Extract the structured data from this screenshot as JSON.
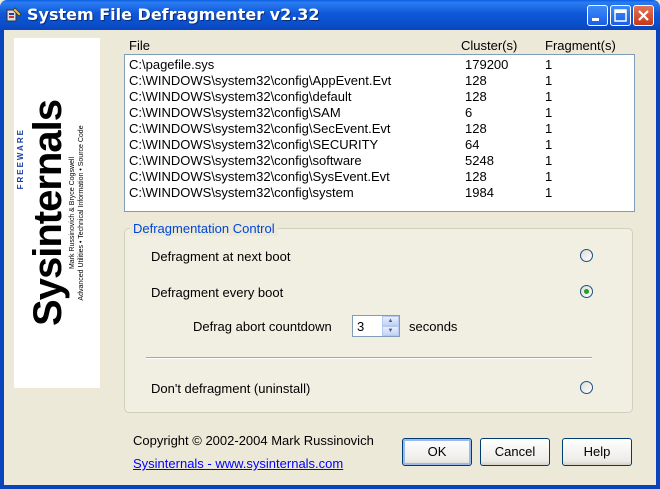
{
  "window": {
    "title": "System File Defragmenter v2.32",
    "controls": [
      "minimize-icon",
      "maximize-icon",
      "close-icon"
    ]
  },
  "logo": {
    "brand": "Sysinternals",
    "freeware": "FREEWARE",
    "tagline1": "Mark Russinovich & Bryce Cogswell",
    "tagline2": "Advanced Utilities • Technical Information • Source Code"
  },
  "file_list": {
    "columns": [
      "File",
      "Cluster(s)",
      "Fragment(s)"
    ],
    "rows": [
      {
        "file": "C:\\pagefile.sys",
        "clusters": "179200",
        "fragments": "1"
      },
      {
        "file": "C:\\WINDOWS\\system32\\config\\AppEvent.Evt",
        "clusters": "128",
        "fragments": "1"
      },
      {
        "file": "C:\\WINDOWS\\system32\\config\\default",
        "clusters": "128",
        "fragments": "1"
      },
      {
        "file": "C:\\WINDOWS\\system32\\config\\SAM",
        "clusters": "6",
        "fragments": "1"
      },
      {
        "file": "C:\\WINDOWS\\system32\\config\\SecEvent.Evt",
        "clusters": "128",
        "fragments": "1"
      },
      {
        "file": "C:\\WINDOWS\\system32\\config\\SECURITY",
        "clusters": "64",
        "fragments": "1"
      },
      {
        "file": "C:\\WINDOWS\\system32\\config\\software",
        "clusters": "5248",
        "fragments": "1"
      },
      {
        "file": "C:\\WINDOWS\\system32\\config\\SysEvent.Evt",
        "clusters": "128",
        "fragments": "1"
      },
      {
        "file": "C:\\WINDOWS\\system32\\config\\system",
        "clusters": "1984",
        "fragments": "1"
      }
    ]
  },
  "control": {
    "title": "Defragmentation Control",
    "next_boot": "Defragment at next boot",
    "every_boot": "Defragment every boot",
    "countdown_label": "Defrag abort countdown",
    "countdown_value": "3",
    "countdown_unit": "seconds",
    "uninstall": "Don't defragment (uninstall)",
    "selected": "every_boot"
  },
  "footer": {
    "copyright": "Copyright © 2002-2004 Mark Russinovich",
    "link": "Sysinternals - www.sysinternals.com"
  },
  "buttons": {
    "ok": "OK",
    "cancel": "Cancel",
    "help": "Help"
  },
  "colors": {
    "titlebar": "#0A4FCB",
    "window_bg": "#ECE9D8",
    "group_title": "#0046D5",
    "radio_selected": "#21A121",
    "link": "#0000FF"
  }
}
